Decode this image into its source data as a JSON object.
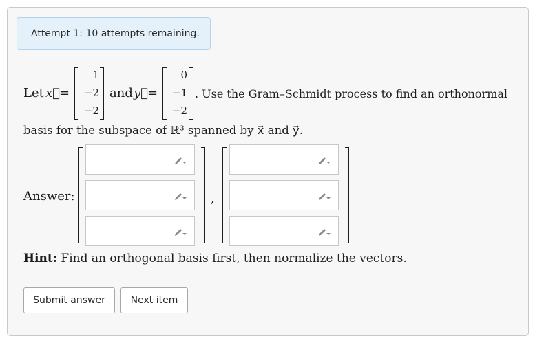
{
  "attempt_banner": "Attempt 1: 10 attempts remaining.",
  "problem": {
    "let_text": "Let",
    "x_var": "x⃗",
    "y_var": "y⃗",
    "equals": "=",
    "and_text": "and",
    "after_text": ". Use the Gram–Schmidt process to find an orthonormal",
    "line2_text": "basis for the subspace of ℝ³ spanned by x⃗ and y⃗.",
    "x_vector": [
      "1",
      "−2",
      "−2"
    ],
    "y_vector": [
      "0",
      "−1",
      "−2"
    ]
  },
  "answer": {
    "label": "Answer:",
    "separator": ",",
    "vector1": [
      "",
      "",
      ""
    ],
    "vector2": [
      "",
      "",
      ""
    ],
    "input_icon": "pencil-dropdown-icon"
  },
  "hint": {
    "label": "Hint:",
    "text": "Find an orthogonal basis first, then normalize the vectors."
  },
  "buttons": {
    "submit": "Submit answer",
    "next": "Next item"
  }
}
